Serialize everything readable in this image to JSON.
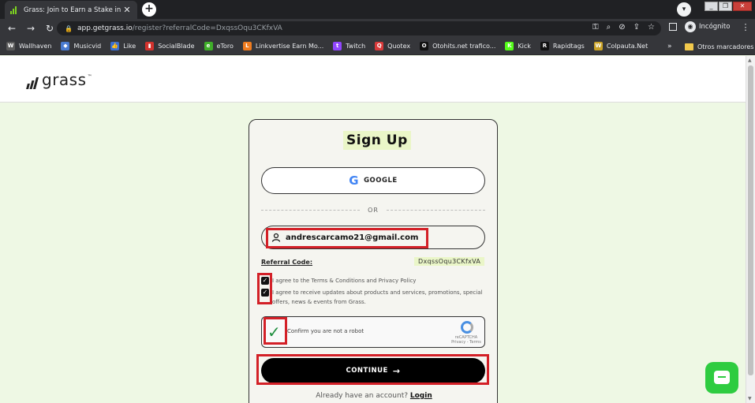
{
  "browser": {
    "tab_title": "Grass: Join to Earn a Stake in AI",
    "url_host": "app.getgrass.io",
    "url_path": "/register?referralCode=DxqssOqu3CKfxVA",
    "profile_label": "Incógnito",
    "bookmarks": [
      {
        "label": "Wallhaven",
        "color": "#5b5b5b",
        "glyph": "W"
      },
      {
        "label": "Musicvid",
        "color": "#4a7bd0",
        "glyph": "◆"
      },
      {
        "label": "Like",
        "color": "#3b6fd1",
        "glyph": "👍"
      },
      {
        "label": "SocialBlade",
        "color": "#d2322d",
        "glyph": "▮"
      },
      {
        "label": "eToro",
        "color": "#3fae29",
        "glyph": "e"
      },
      {
        "label": "Linkvertise Earn Mo...",
        "color": "#f07c1f",
        "glyph": "L"
      },
      {
        "label": "Twitch",
        "color": "#9146ff",
        "glyph": "t"
      },
      {
        "label": "Quotex",
        "color": "#d93a3a",
        "glyph": "Q"
      },
      {
        "label": "Otohits.net trafico...",
        "color": "#111111",
        "glyph": "O"
      },
      {
        "label": "Kick",
        "color": "#53fc18",
        "glyph": "K"
      },
      {
        "label": "Rapidtags",
        "color": "#111111",
        "glyph": "R"
      },
      {
        "label": "Colpauta.Net",
        "color": "#c9a227",
        "glyph": "W"
      }
    ],
    "bookmarks_more": "»",
    "other_bookmarks": "Otros marcadores"
  },
  "page": {
    "logo_text": "grass",
    "logo_tm": "™",
    "signup_title": "Sign Up",
    "google_label": "GOOGLE",
    "or_label": "OR",
    "email_value": "andrescarcamo21@gmail.com",
    "referral_label": "Referral Code:",
    "referral_code": "DxqssOqu3CKfxVA",
    "terms_text": "I agree to the Terms & Conditions and Privacy Policy",
    "updates_text": "I agree to receive updates about products and services, promotions, special offers, news & events from Grass.",
    "captcha_label": "Confirm you are not a robot",
    "captcha_brand": "reCAPTCHA",
    "captcha_links": "Privacy - Terms",
    "continue_label": "CONTINUE",
    "have_account": "Already have an account?",
    "login_label": "Login"
  },
  "colors": {
    "accent_highlight": "#eaf6c8",
    "page_bg": "#eef8e4",
    "annotation_red": "#d32027",
    "chat_green": "#2ecc40"
  }
}
